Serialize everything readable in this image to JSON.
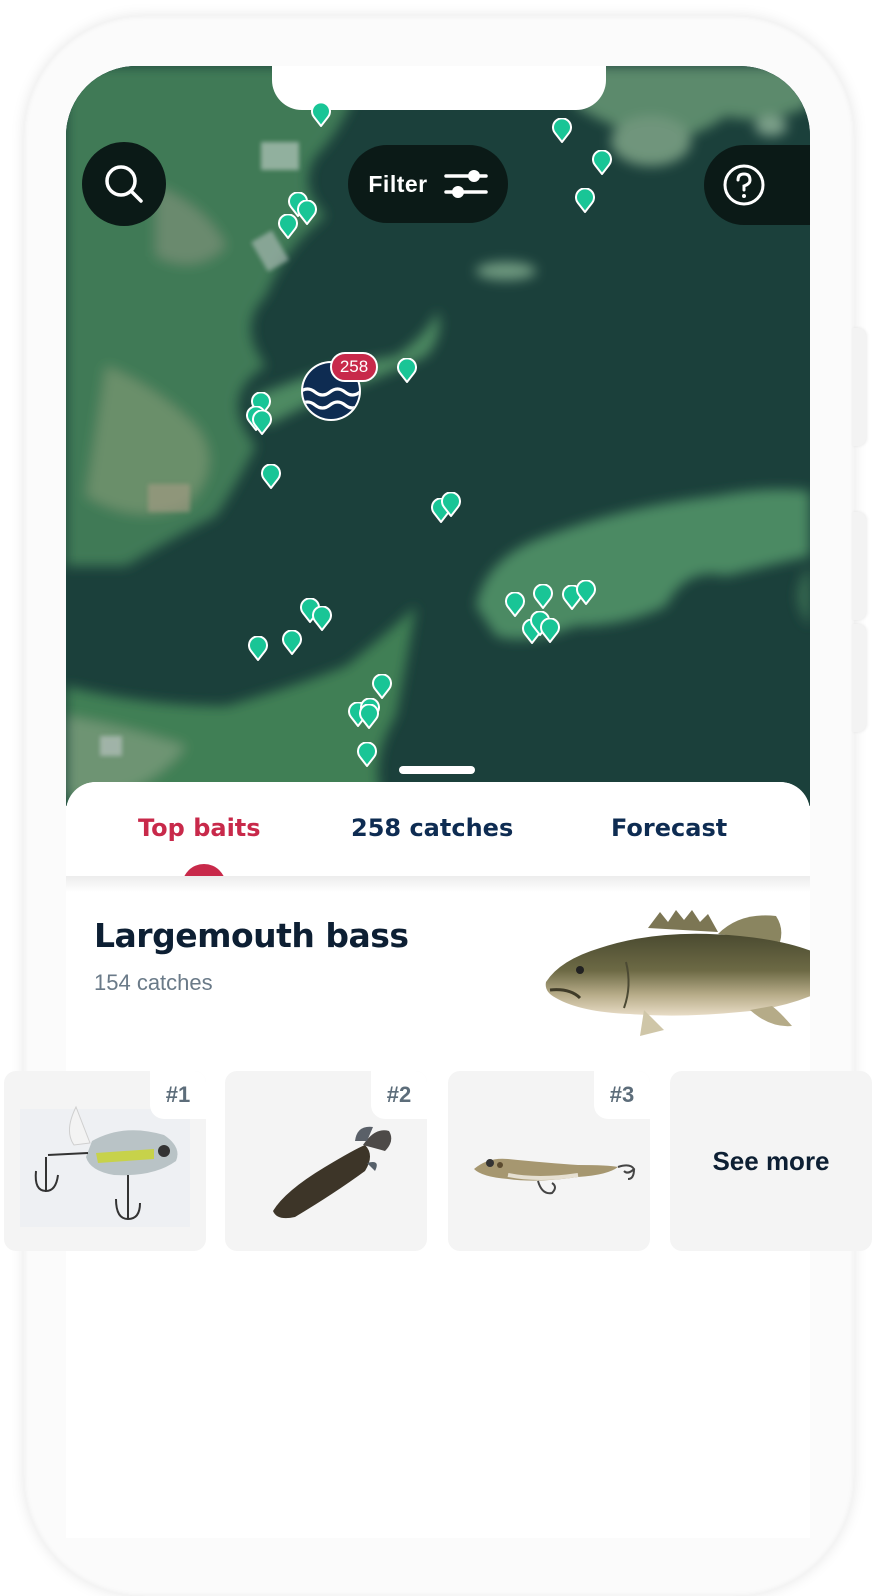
{
  "map": {
    "search_button": {
      "icon": "search-icon"
    },
    "filter_button": {
      "label": "Filter",
      "icon": "sliders-icon"
    },
    "help_button": {
      "icon": "question-circle-icon"
    },
    "cluster": {
      "count": "258",
      "icon": "water-waves-icon"
    },
    "pin_color": "#19c596"
  },
  "tabs": [
    {
      "label": "Top baits",
      "active": true
    },
    {
      "label": "258 catches",
      "active": false
    },
    {
      "label": "Forecast",
      "active": false
    }
  ],
  "species": {
    "name": "Largemouth bass",
    "catches": "154 catches"
  },
  "baits": [
    {
      "rank": "#1",
      "image": "topwater-prop-lure"
    },
    {
      "rank": "#2",
      "image": "soft-plastic-creature-bait"
    },
    {
      "rank": "#3",
      "image": "frog-lure"
    }
  ],
  "see_more_label": "See more",
  "colors": {
    "accent_red": "#c8294a",
    "navy": "#0e2c52",
    "pin_green": "#19c596",
    "button_dark": "#0b1a17"
  }
}
